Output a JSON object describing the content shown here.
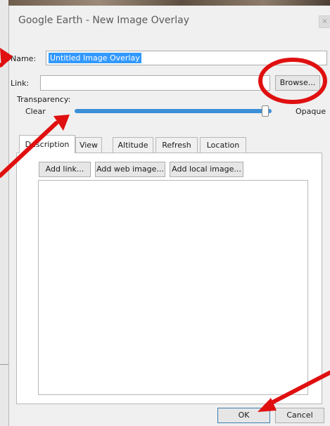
{
  "window": {
    "title": "Google Earth - New Image Overlay"
  },
  "fields": {
    "name_label": "Name:",
    "name_value": "Untitled Image Overlay",
    "link_label": "Link:",
    "link_value": "",
    "browse_label": "Browse..."
  },
  "transparency": {
    "label": "Transparency:",
    "min_label": "Clear",
    "max_label": "Opaque",
    "level": 1.0
  },
  "tabs": [
    {
      "label": "Description",
      "active": true
    },
    {
      "label": "View",
      "active": false
    },
    {
      "label": "Altitude",
      "active": false
    },
    {
      "label": "Refresh",
      "active": false
    },
    {
      "label": "Location",
      "active": false
    }
  ],
  "description": {
    "add_link_label": "Add link...",
    "add_web_image_label": "Add web image...",
    "add_local_image_label": "Add local image..."
  },
  "footer": {
    "ok_label": "OK",
    "cancel_label": "Cancel"
  },
  "annotation_colors": {
    "arrow": "#e01010",
    "circle": "#e01010"
  }
}
